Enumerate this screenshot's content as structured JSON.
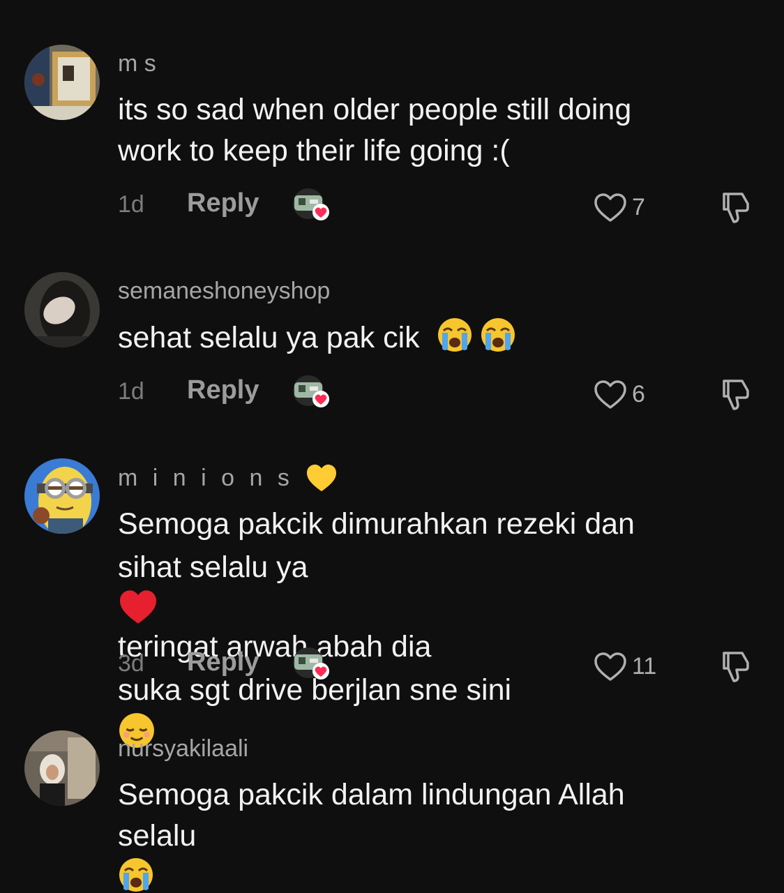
{
  "comments": [
    {
      "username": "m s",
      "text_lines": [
        "its so sad when older people still doing",
        "work to keep their life going :("
      ],
      "time": "1d",
      "reply_label": "Reply",
      "likes": "7",
      "avatar_icon": "framed-picture-avatar"
    },
    {
      "username": "semaneshoneyshop",
      "text_lines": [
        "sehat selalu ya pak cik"
      ],
      "text_emojis": [
        "loudly-crying-face",
        "loudly-crying-face"
      ],
      "time": "1d",
      "reply_label": "Reply",
      "likes": "6",
      "avatar_icon": "hand-over-face-avatar"
    },
    {
      "username": "m i n i o n s",
      "username_emoji": "yellow-heart",
      "text_lines": [
        "Semoga pakcik dimurahkan rezeki dan",
        "sihat selalu ya",
        "teringat arwah abah dia",
        "suka sgt drive berjlan sne sini"
      ],
      "text_emojis": [
        "red-heart",
        "relieved-face"
      ],
      "time": "3d",
      "reply_label": "Reply",
      "likes": "11",
      "avatar_icon": "minion-avatar"
    },
    {
      "username": "nursyakilaali",
      "text_lines": [
        "Semoga pakcik dalam lindungan Allah",
        "selalu"
      ],
      "text_emojis": [
        "loudly-crying-face"
      ],
      "avatar_icon": "mirror-selfie-avatar"
    }
  ],
  "icons": {
    "like": "heart-outline-icon",
    "dislike": "thumbs-down-icon",
    "creator_liked": "creator-avatar-with-heart"
  },
  "colors": {
    "background": "#0f0f0f",
    "username": "#a6a6a6",
    "text": "#f2f2f2",
    "meta": "#7d7d7d",
    "heart": "#fe2c55"
  }
}
